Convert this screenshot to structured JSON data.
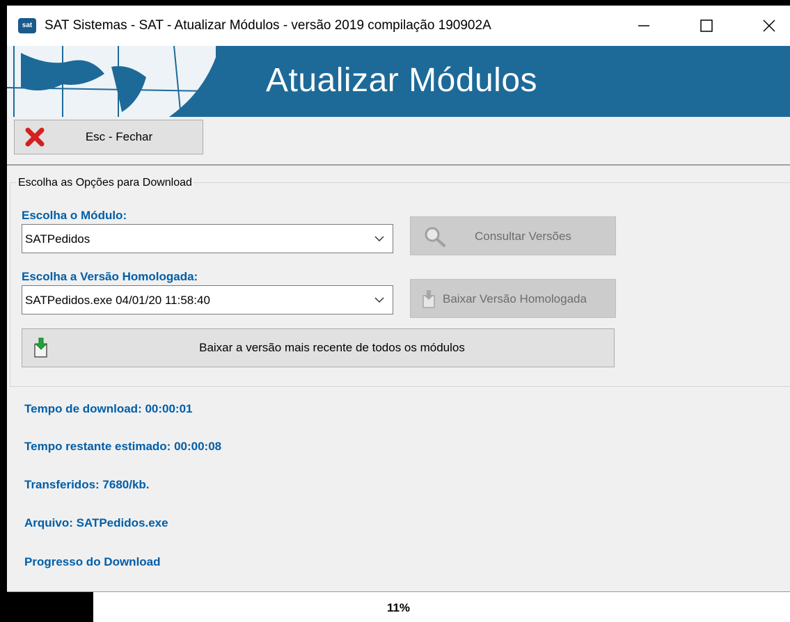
{
  "window": {
    "title": "SAT Sistemas - SAT - Atualizar Módulos - versão 2019 compilação 190902A",
    "app_icon_text": "sat",
    "controls": {
      "minimize_icon": "minimize-icon",
      "maximize_icon": "maximize-icon",
      "close_icon": "close-icon"
    }
  },
  "banner": {
    "title": "Atualizar Módulos"
  },
  "toolbar": {
    "close_button_label": "Esc - Fechar"
  },
  "options": {
    "legend": "Escolha as Opções para Download",
    "module_label": "Escolha o Módulo:",
    "module_value": "SATPedidos",
    "check_versions_label": "Consultar Versões",
    "version_label": "Escolha a Versão Homologada:",
    "version_value": "SATPedidos.exe 04/01/20 11:58:40",
    "download_homologated_label": "Baixar Versão Homologada",
    "download_all_label": "Baixar a versão mais recente de todos os módulos"
  },
  "status": {
    "download_time": "Tempo de download: 00:00:01",
    "remaining_time": "Tempo restante estimado: 00:00:08",
    "transferred": "Transferidos: 7680/kb.",
    "file": "Arquivo: SATPedidos.exe",
    "progress_label": "Progresso do Download"
  },
  "progress": {
    "text": "11%",
    "value": 0.11
  },
  "colors": {
    "banner": "#1d6a98",
    "label_blue": "#005ea8"
  }
}
